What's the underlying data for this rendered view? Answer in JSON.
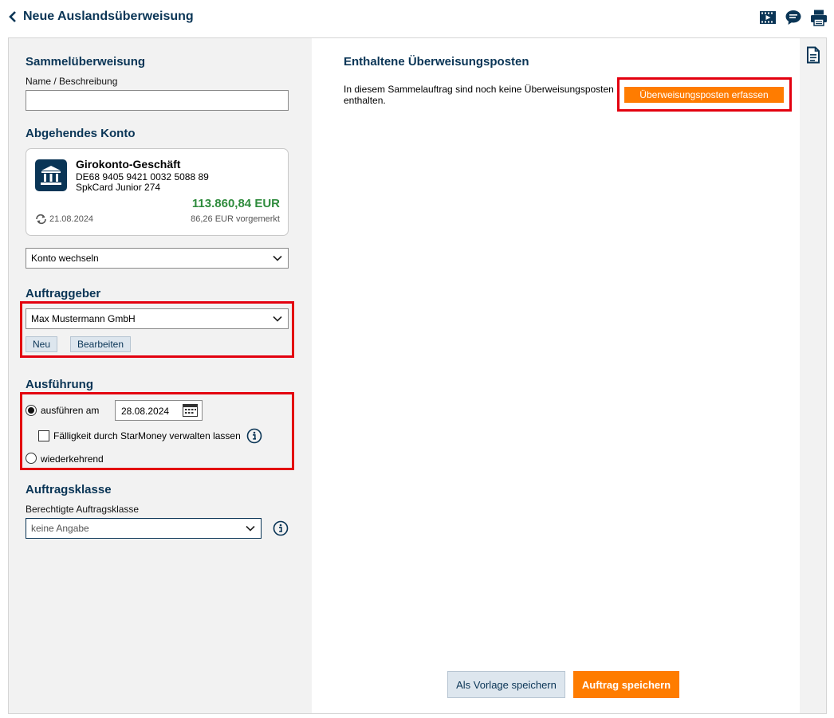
{
  "header": {
    "title": "Neue Auslandsüberweisung",
    "icons": [
      "video-icon",
      "chat-icon",
      "print-icon"
    ]
  },
  "sammel": {
    "title": "Sammelüberweisung",
    "name_label": "Name / Beschreibung",
    "name_value": "",
    "name_placeholder": ""
  },
  "konto": {
    "title": "Abgehendes Konto",
    "card": {
      "name": "Girokonto-Geschäft",
      "iban": "DE68 9405 9421 0032 5088 89",
      "type": "SpkCard Junior 274",
      "balance": "113.860,84 EUR",
      "date": "21.08.2024",
      "reserved": "86,26 EUR vorgemerkt"
    },
    "switch_label": "Konto wechseln"
  },
  "auftraggeber": {
    "title": "Auftraggeber",
    "selected": "Max Mustermann GmbH",
    "new_label": "Neu",
    "edit_label": "Bearbeiten"
  },
  "ausfuehrung": {
    "title": "Ausführung",
    "option_date_label": "ausführen am",
    "date_value": "28.08.2024",
    "checkbox_label": "Fälligkeit durch StarMoney verwalten lassen",
    "option_recurring_label": "wiederkehrend"
  },
  "auftragsklasse": {
    "title": "Auftragsklasse",
    "field_label": "Berechtigte Auftragsklasse",
    "selected": "keine Angabe"
  },
  "main": {
    "title": "Enthaltene Überweisungsposten",
    "empty_message": "In diesem Sammelauftrag sind noch keine Überweisungsposten enthalten.",
    "add_button": "Überweisungsposten erfassen",
    "save_template_button": "Als Vorlage speichern",
    "save_order_button": "Auftrag speichern"
  },
  "colors": {
    "brand_blue": "#0a3556",
    "accent_orange": "#ff7c00",
    "balance_green": "#2e8b3c",
    "highlight_red": "#e3000f"
  }
}
